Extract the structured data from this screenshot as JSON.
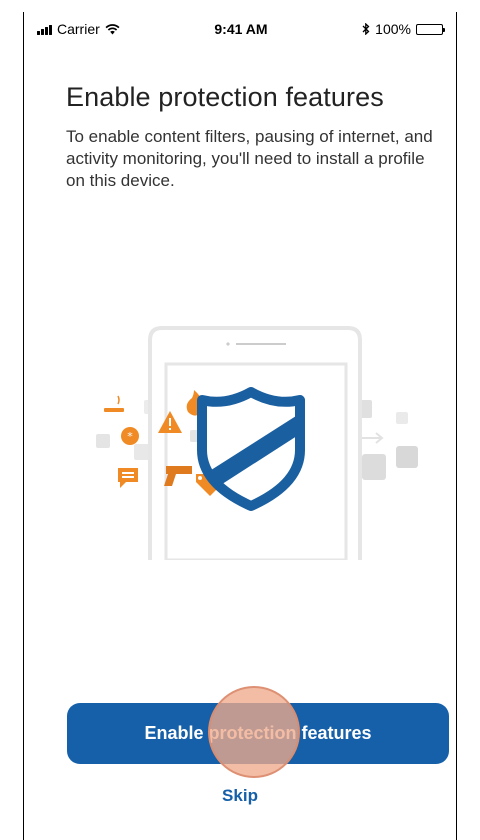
{
  "status_bar": {
    "carrier": "Carrier",
    "time": "9:41 AM",
    "battery_percent": "100%",
    "icons": [
      "signal-icon",
      "wifi-icon",
      "bluetooth-icon",
      "battery-icon"
    ]
  },
  "screen": {
    "title": "Enable protection features",
    "description": "To enable content filters, pausing of internet, and activity monitoring, you'll need to install a profile on this device."
  },
  "illustration": {
    "icons": [
      "phone-outline-icon",
      "shield-icon",
      "cigarette-icon",
      "alert-icon",
      "fire-icon",
      "chat-icon",
      "gun-icon",
      "price-tag-icon",
      "badge-icon"
    ]
  },
  "actions": {
    "primary_label": "Enable protection features",
    "skip_label": "Skip"
  },
  "colors": {
    "accent": "#1560a8",
    "shield": "#1a5fa0",
    "warning_orange": "#f08a24",
    "tap_indicator": "#f0aa8c"
  }
}
